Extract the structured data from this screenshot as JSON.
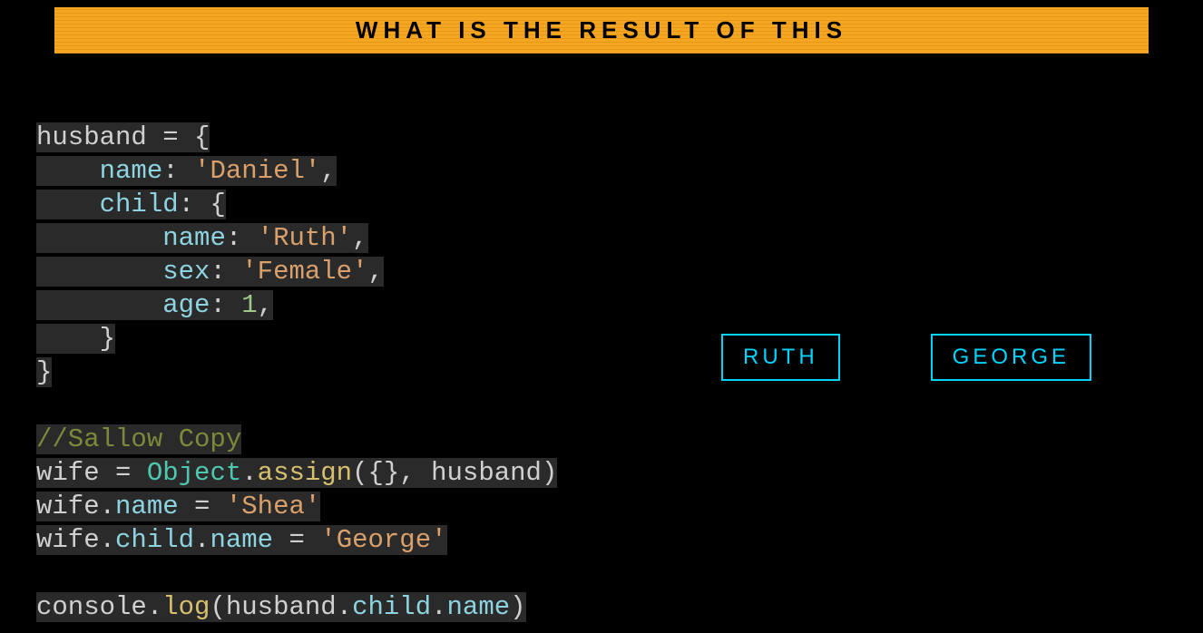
{
  "title": "WHAT IS THE RESULT OF THIS",
  "code": {
    "l1_a": "husband",
    "l1_b": " = {",
    "l2_a": "    ",
    "l2_b": "name",
    "l2_c": ":",
    "l2_d": " 'Daniel'",
    "l2_e": ",",
    "l3_a": "    ",
    "l3_b": "child",
    "l3_c": ":",
    "l3_d": " {",
    "l4_a": "        ",
    "l4_b": "name",
    "l4_c": ":",
    "l4_d": " 'Ruth'",
    "l4_e": ",",
    "l5_a": "        ",
    "l5_b": "sex",
    "l5_c": ":",
    "l5_d": " 'Female'",
    "l5_e": ",",
    "l6_a": "        ",
    "l6_b": "age",
    "l6_c": ":",
    "l6_d": " 1",
    "l6_e": ",",
    "l7_a": "    ",
    "l7_b": "}",
    "l8_a": "}",
    "l10_a": "//Sallow Copy",
    "l11_a": "wife",
    "l11_b": " = ",
    "l11_c": "Object",
    "l11_d": ".",
    "l11_e": "assign",
    "l11_f": "({}, ",
    "l11_g": "husband",
    "l11_h": ")",
    "l12_a": "wife",
    "l12_b": ".",
    "l12_c": "name",
    "l12_d": " = ",
    "l12_e": "'Shea'",
    "l13_a": "wife",
    "l13_b": ".",
    "l13_c": "child",
    "l13_d": ".",
    "l13_e": "name",
    "l13_f": " = ",
    "l13_g": "'George'",
    "l15_a": "console",
    "l15_b": ".",
    "l15_c": "log",
    "l15_d": "(",
    "l15_e": "husband",
    "l15_f": ".",
    "l15_g": "child",
    "l15_h": ".",
    "l15_i": "name",
    "l15_j": ")"
  },
  "answers": {
    "a": "RUTH",
    "b": "GEORGE"
  }
}
